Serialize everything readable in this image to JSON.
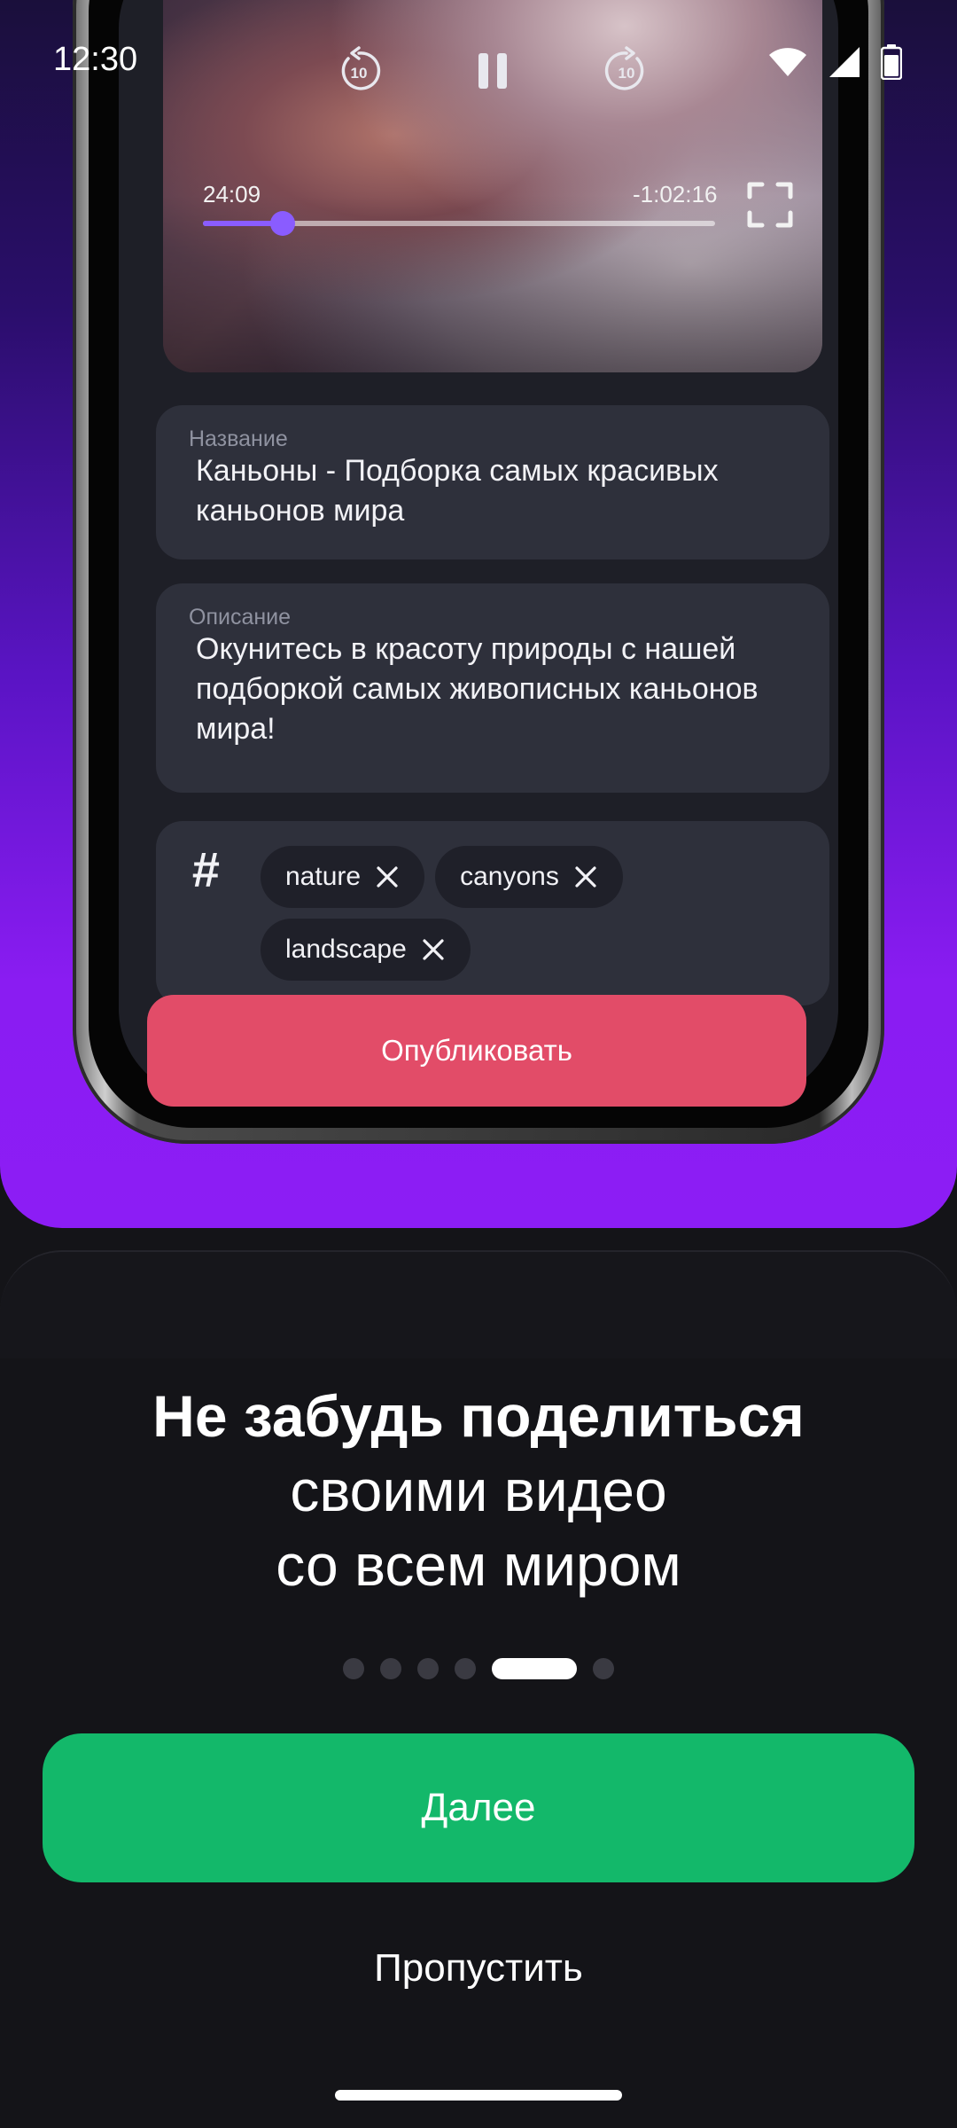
{
  "status_bar": {
    "time": "12:30",
    "icons": [
      "wifi-icon",
      "cell-signal-icon",
      "battery-icon"
    ]
  },
  "video_player": {
    "current_time": "24:09",
    "remaining_time": "-1:02:16",
    "progress": 0.155,
    "controls": [
      "rewind-10-icon",
      "pause-icon",
      "forward-10-icon",
      "fullscreen-icon"
    ],
    "rewind_seconds": "10",
    "forward_seconds": "10"
  },
  "form": {
    "title_label": "Название",
    "title_value": "Каньоны - Подборка самых красивых каньонов мира",
    "description_label": "Описание",
    "description_value": "Окунитесь в красоту природы с нашей подборкой самых живописных каньонов мира!",
    "hashtag_symbol": "#",
    "tags": [
      {
        "label": "nature"
      },
      {
        "label": "canyons"
      },
      {
        "label": "landscape"
      }
    ],
    "publish_label": "Опубликовать"
  },
  "onboarding": {
    "headline_bold": "Не забудь поделиться",
    "headline_line2": "своими видео",
    "headline_line3": "со всем миром",
    "page_count": 6,
    "active_page": 4,
    "next_label": "Далее",
    "skip_label": "Пропустить"
  },
  "colors": {
    "accent_purple": "#8c1df5",
    "publish_red": "#e24c68",
    "next_green": "#13b86a",
    "progress": "#8a5cff",
    "background": "#141418"
  }
}
